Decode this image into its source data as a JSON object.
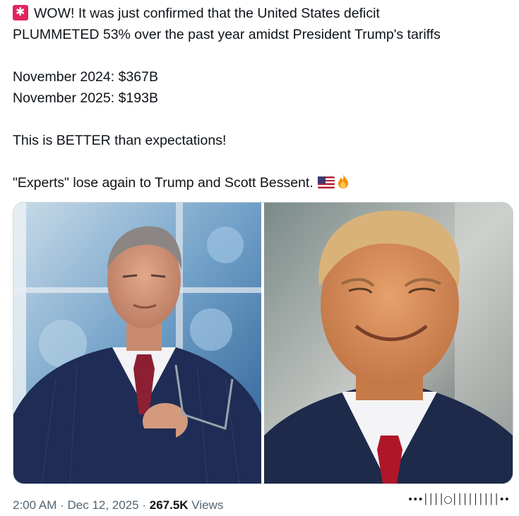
{
  "tweet": {
    "line1": "WOW! It was just confirmed that the United States deficit",
    "line2": "PLUMMETED 53% over the past year amidst President Trump's tariffs",
    "stat1": "November 2024: $367B",
    "stat2": "November 2025: $193B",
    "line3": "This is BETTER than expectations!",
    "line4": "\"Experts\" lose again to Trump and Scott Bessent."
  },
  "icons": {
    "lead": "rotating-light-icon",
    "trail": [
      "us-flag-icon",
      "fire-icon"
    ]
  },
  "media": {
    "left": "photo-man-in-suit-holding-glasses",
    "right": "photo-smiling-man-in-suit"
  },
  "meta": {
    "time": "2:00 AM",
    "sep1": " · ",
    "date": "Dec 12, 2025",
    "sep2": " · ",
    "views_count": "267.5K",
    "views_label": " Views"
  },
  "watermark": "•••││││○│││││││││••"
}
